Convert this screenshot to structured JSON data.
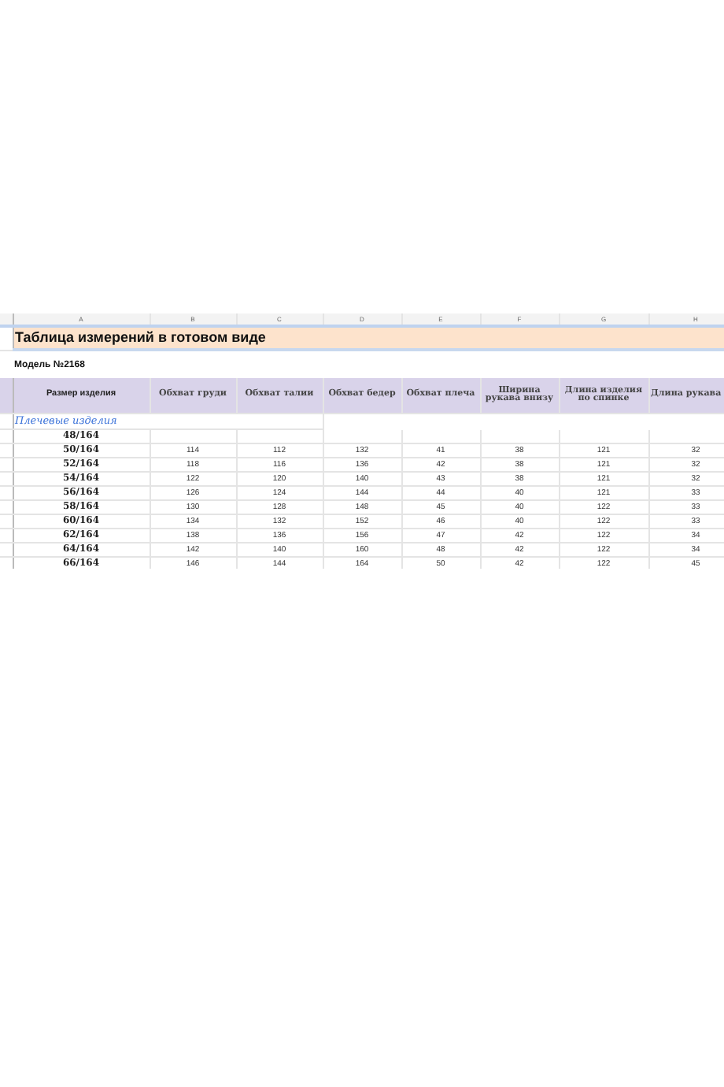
{
  "sheet": {
    "column_letters": [
      "A",
      "B",
      "C",
      "D",
      "E",
      "F",
      "G",
      "H"
    ],
    "title": "Таблица измерений в готовом виде",
    "model": "Модель №2168",
    "headers": [
      "Размер изделия",
      "Обхват груди",
      "Обхват талии",
      "Обхват бедер",
      "Обхват плеча",
      "Ширина рукава внизу",
      "Длина изделия по спинке",
      "Длина рукава"
    ],
    "section": "Плечевые изделия",
    "rows": [
      {
        "size": "48/164",
        "values": []
      },
      {
        "size": "50/164",
        "values": [
          "114",
          "112",
          "132",
          "41",
          "38",
          "121",
          "32"
        ]
      },
      {
        "size": "52/164",
        "values": [
          "118",
          "116",
          "136",
          "42",
          "38",
          "121",
          "32"
        ]
      },
      {
        "size": "54/164",
        "values": [
          "122",
          "120",
          "140",
          "43",
          "38",
          "121",
          "32"
        ]
      },
      {
        "size": "56/164",
        "values": [
          "126",
          "124",
          "144",
          "44",
          "40",
          "121",
          "33"
        ]
      },
      {
        "size": "58/164",
        "values": [
          "130",
          "128",
          "148",
          "45",
          "40",
          "122",
          "33"
        ]
      },
      {
        "size": "60/164",
        "values": [
          "134",
          "132",
          "152",
          "46",
          "40",
          "122",
          "33"
        ]
      },
      {
        "size": "62/164",
        "values": [
          "138",
          "136",
          "156",
          "47",
          "42",
          "122",
          "34"
        ]
      },
      {
        "size": "64/164",
        "values": [
          "142",
          "140",
          "160",
          "48",
          "42",
          "122",
          "34"
        ]
      },
      {
        "size": "66/164",
        "values": [
          "146",
          "144",
          "164",
          "50",
          "42",
          "122",
          "45"
        ]
      }
    ]
  }
}
